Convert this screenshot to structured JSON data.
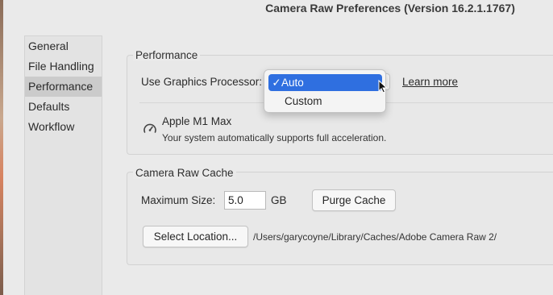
{
  "window": {
    "title": "Camera Raw Preferences  (Version 16.2.1.1767)"
  },
  "sidebar": {
    "items": [
      {
        "label": "General"
      },
      {
        "label": "File Handling"
      },
      {
        "label": "Performance",
        "selected": true
      },
      {
        "label": "Defaults"
      },
      {
        "label": "Workflow"
      }
    ]
  },
  "performance": {
    "group_label": "Performance",
    "gpu_label": "Use Graphics Processor:",
    "gpu_options": [
      "Auto",
      "Custom"
    ],
    "gpu_selected": "Auto",
    "learn_more": "Learn more",
    "gpu_icon": "gauge-icon",
    "gpu_name": "Apple M1 Max",
    "gpu_status": "Your system automatically supports full acceleration."
  },
  "cache": {
    "group_label": "Camera Raw Cache",
    "max_size_label": "Maximum Size:",
    "max_size_value": "5.0",
    "unit": "GB",
    "purge_button": "Purge Cache",
    "select_location_button": "Select Location...",
    "path": "/Users/garycoyne/Library/Caches/Adobe Camera Raw 2/"
  },
  "colors": {
    "accent": "#2f6fe0",
    "window_bg": "#eaeaea",
    "sidebar_selected": "#cbcbcb"
  }
}
